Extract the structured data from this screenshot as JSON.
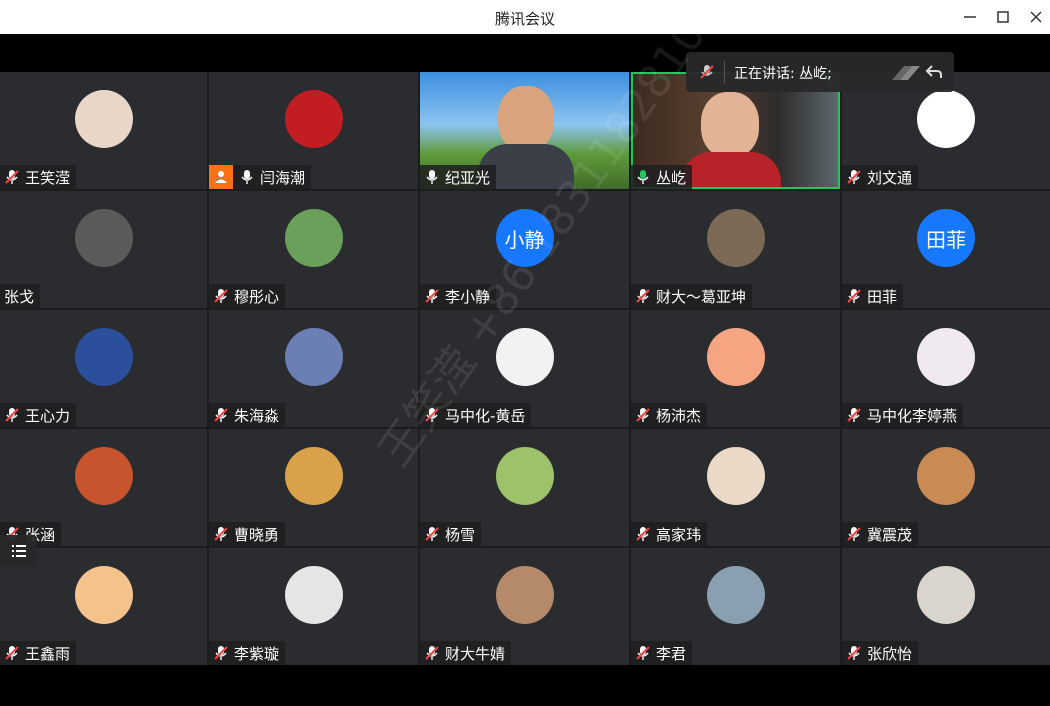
{
  "window": {
    "title": "腾讯会议"
  },
  "speaking": {
    "text": "正在讲话: 丛屹;"
  },
  "watermark": "王笑滢 +86 18311828104",
  "colors": {
    "mic_muted": "#ef4444",
    "mic_active": "#22c55e",
    "avatar_blue": "#1677ff",
    "host_badge": "#f97316"
  },
  "participants": [
    {
      "name": "王笑滢",
      "mic": "muted"
    },
    {
      "name": "闫海潮",
      "mic": "on",
      "host": true
    },
    {
      "name": "纪亚光",
      "mic": "on",
      "video": true
    },
    {
      "name": "丛屹",
      "mic": "speaking",
      "video": true
    },
    {
      "name": "刘文通",
      "mic": "muted"
    },
    {
      "name": "张戈",
      "mic": "none"
    },
    {
      "name": "穆彤心",
      "mic": "muted"
    },
    {
      "name": "李小静",
      "mic": "muted",
      "initials": "小静"
    },
    {
      "name": "财大～葛亚坤",
      "mic": "muted"
    },
    {
      "name": "田菲",
      "mic": "muted",
      "initials": "田菲"
    },
    {
      "name": "王心力",
      "mic": "muted"
    },
    {
      "name": "朱海淼",
      "mic": "muted"
    },
    {
      "name": "马中化-黄岳",
      "mic": "muted"
    },
    {
      "name": "杨沛杰",
      "mic": "muted"
    },
    {
      "name": "马中化李婷燕",
      "mic": "muted"
    },
    {
      "name": "张涵",
      "mic": "muted"
    },
    {
      "name": "曹晓勇",
      "mic": "muted"
    },
    {
      "name": "杨雪",
      "mic": "muted"
    },
    {
      "name": "高家玮",
      "mic": "muted"
    },
    {
      "name": "冀震茂",
      "mic": "muted"
    },
    {
      "name": "王鑫雨",
      "mic": "muted"
    },
    {
      "name": "李紫璇",
      "mic": "muted"
    },
    {
      "name": "财大牛婧",
      "mic": "muted"
    },
    {
      "name": "李君",
      "mic": "muted"
    },
    {
      "name": "张欣怡",
      "mic": "muted"
    }
  ]
}
